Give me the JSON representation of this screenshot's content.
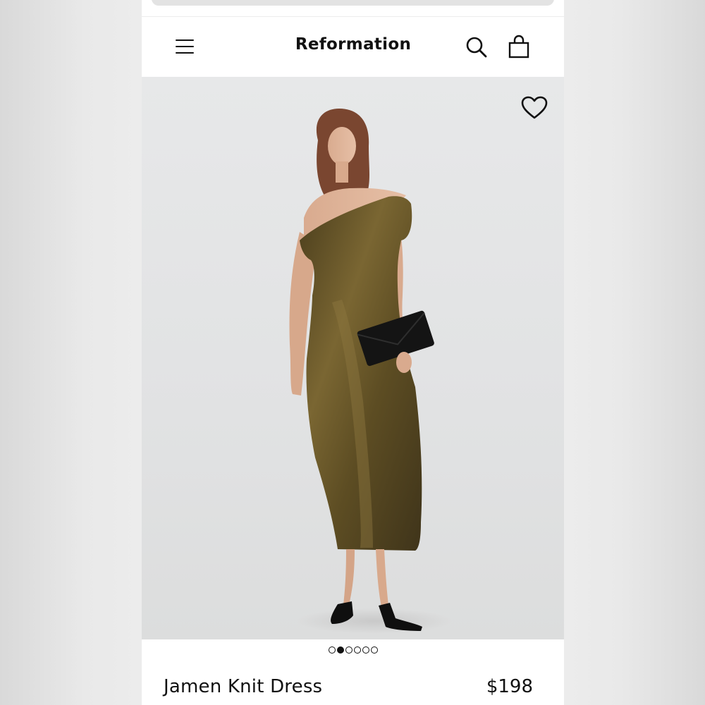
{
  "header": {
    "brand": "Reformation",
    "icons": {
      "menu": "hamburger-menu-icon",
      "search": "search-icon",
      "bag": "shopping-bag-icon"
    }
  },
  "product": {
    "name": "Jamen Knit Dress",
    "price": "$198",
    "image_alt": "Model wearing a gold metallic one-shoulder knit midi dress holding a black clutch",
    "favorite_icon": "heart-outline-icon"
  },
  "carousel": {
    "total": 6,
    "active_index": 1
  },
  "colors": {
    "accent": "#111111",
    "dress": "#6b5a2e",
    "background": "#e3e4e5"
  }
}
